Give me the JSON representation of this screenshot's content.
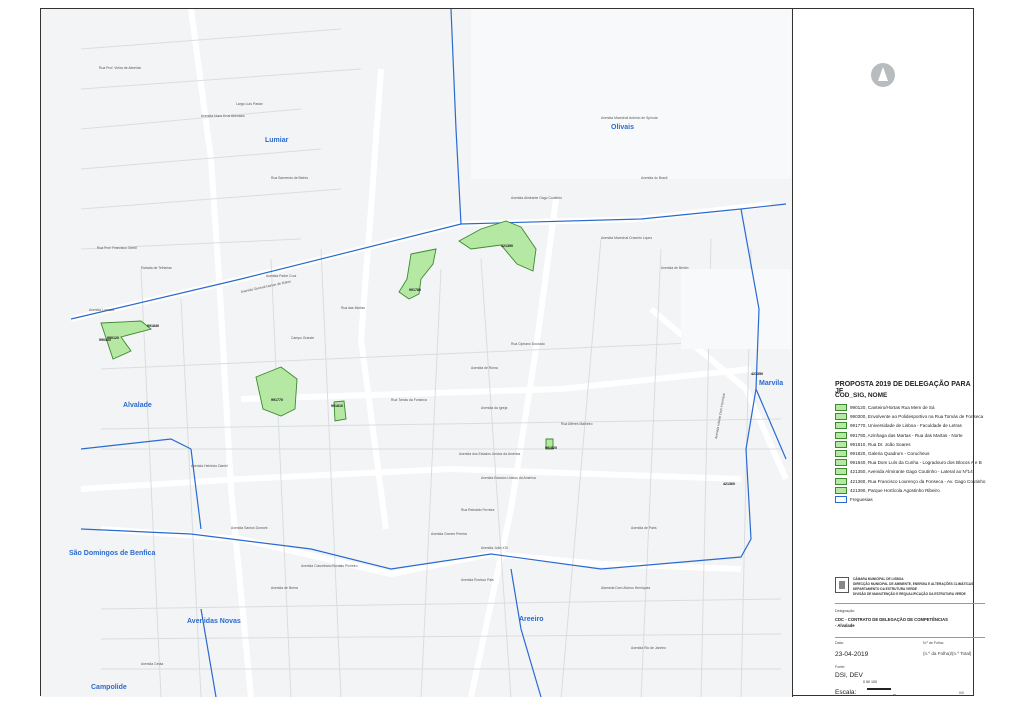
{
  "legend": {
    "title": "PROPOSTA 2019 DE DELEGAÇÃO PARA JF",
    "subtitle": "COD_SIG, NOME",
    "items": [
      {
        "label": "990120, Canteiro/Hortas Rua Mem de Sá"
      },
      {
        "label": "990300, Envolvente ao Polidesportivo na Rua Tomás de Fonseca"
      },
      {
        "label": "991770, Universidade de Lisboa - Faculdade de Letras"
      },
      {
        "label": "991780, Azinhaga das Martas - Rua das Martas - Norte"
      },
      {
        "label": "991810, Rua Dr. João Soares"
      },
      {
        "label": "991820, Galeria Quadrum - Corucheus"
      },
      {
        "label": "991840, Rua Dom Luís da Cunha - Logradouro dos Blocos A e B"
      },
      {
        "label": "421350, Avenida Almirante Gago Coutinho - Lateral ao Nº14"
      },
      {
        "label": "421360, Rua Francisco Lourenço da Fonseca - Av. Gago Coutinho"
      },
      {
        "label": "421390, Parque Hortícola Agostinho Ribeiro"
      },
      {
        "label": "Freguesias"
      }
    ],
    "colors": {
      "area_fill": "#b5e8a3",
      "area_stroke": "#3b8a2e",
      "parish_line": "#2a6ad0"
    }
  },
  "map": {
    "north_arrow_icon": "north-arrow-icon",
    "parishes": [
      {
        "id": "lumiar",
        "name": "Lumiar"
      },
      {
        "id": "olivais",
        "name": "Olivais"
      },
      {
        "id": "marvila",
        "name": "Marvila"
      },
      {
        "id": "alvalade",
        "name": "Alvalade"
      },
      {
        "id": "sao-domingos",
        "name": "São Domingos de Benfica"
      },
      {
        "id": "avenidas-novas",
        "name": "Avenidas Novas"
      },
      {
        "id": "areeiro",
        "name": "Areeiro"
      },
      {
        "id": "campolide",
        "name": "Campolide"
      }
    ],
    "area_codes": [
      {
        "id": "a421390",
        "code": "421390"
      },
      {
        "id": "a991780",
        "code": "991780"
      },
      {
        "id": "a991770",
        "code": "991770"
      },
      {
        "id": "a990120",
        "code": "990120"
      },
      {
        "id": "a991810",
        "code": "991810"
      },
      {
        "id": "a991820",
        "code": "991820"
      },
      {
        "id": "a991840",
        "code": "991840"
      },
      {
        "id": "a421350",
        "code": "421350"
      },
      {
        "id": "a421360",
        "code": "421360"
      },
      {
        "id": "a990300",
        "code": "990300"
      }
    ],
    "streets": [
      {
        "id": "s1",
        "name": "Rua Prof. Vieira de Almeida"
      },
      {
        "id": "s2",
        "name": "Largo Luís Pastor"
      },
      {
        "id": "s3",
        "name": "Avenida Nuno Krus Abecasis"
      },
      {
        "id": "s4",
        "name": "Rua Prof. Francisco Gentil"
      },
      {
        "id": "s5",
        "name": "Estrada de Telheiras"
      },
      {
        "id": "s6",
        "name": "Avenida Padre Cruz"
      },
      {
        "id": "s7",
        "name": "Avenida General Norton de Matos"
      },
      {
        "id": "s8",
        "name": "Rua Sarmento de Beires"
      },
      {
        "id": "s9",
        "name": "Avenida de Roma"
      },
      {
        "id": "s10",
        "name": "Avenida dos Estados Unidos da América"
      },
      {
        "id": "s11",
        "name": "Avenida Rovisco Pais"
      },
      {
        "id": "s12",
        "name": "Avenida Almirante Gago Coutinho"
      },
      {
        "id": "s13",
        "name": "Avenida Marechal Craveiro Lopes"
      },
      {
        "id": "s14",
        "name": "Avenida do Brasil"
      },
      {
        "id": "s15",
        "name": "Avenida Infante Dom Henrique"
      },
      {
        "id": "s16",
        "name": "Avenida de Berlim"
      },
      {
        "id": "s17",
        "name": "Campo Grande"
      },
      {
        "id": "s18",
        "name": "Avenida da Igreja"
      },
      {
        "id": "s19",
        "name": "Rua das Murtas"
      },
      {
        "id": "s20",
        "name": "Avenida Lusíada"
      },
      {
        "id": "s21",
        "name": "Avenida Helvécio Daniel"
      },
      {
        "id": "s22",
        "name": "Avenida de Paris"
      },
      {
        "id": "s23",
        "name": "Avenida João XXI"
      },
      {
        "id": "s24",
        "name": "Rua Reinaldo Ferreira"
      },
      {
        "id": "s25",
        "name": "Avenida Estados Unidos da América"
      },
      {
        "id": "s26",
        "name": "Avenida Columbano Bordalo Pinheiro"
      },
      {
        "id": "s27",
        "name": "Avenida de Berna"
      },
      {
        "id": "s28",
        "name": "Alameda Dom Afonso Henriques"
      },
      {
        "id": "s29",
        "name": "Avenida Rio de Janeiro"
      },
      {
        "id": "s30",
        "name": "Avenida Marechal António de Spínola"
      },
      {
        "id": "s31",
        "name": "Rua Tomás da Fonseca"
      },
      {
        "id": "s32",
        "name": "Avenida Ceuta"
      },
      {
        "id": "s33",
        "name": "Avenida Santos Dumont"
      },
      {
        "id": "s34",
        "name": "Avenida Gomes Pereira"
      },
      {
        "id": "s35",
        "name": "Rua Alferes Malheiro"
      },
      {
        "id": "s36",
        "name": "Rua Cipriano Dourado"
      }
    ]
  },
  "title_block": {
    "org_lines": [
      "CÂMARA MUNICIPAL DE LISBOA",
      "DIRECÇÃO MUNICIPAL DE AMBIENTE, ENERGIA E ALTERAÇÕES CLIMÁTICAS",
      "DEPARTAMENTO DA ESTRUTURA VERDE",
      "DIVISÃO DE MANUTENÇÃO E REQUALIFICAÇÃO DA ESTRUTURA VERDE"
    ],
    "designacao_label": "Designação:",
    "designacao_line1": "CDC - CONTRATO DE DELEGAÇÃO DE COMPETÊNCIAS",
    "designacao_line2": "- Alvalade",
    "data_label": "Data:",
    "date": "23-04-2019",
    "folha_label": "N.º de Folha:",
    "folha_value": "(n.º da Folha)/(n.º Total)",
    "fonte_label": "Fonte:",
    "fonte_value": "DSI, DEV",
    "escala_label": "Escala:",
    "scale_ticks": "0      50     100",
    "scale_unit": "m",
    "sheet_code": "0/0"
  }
}
